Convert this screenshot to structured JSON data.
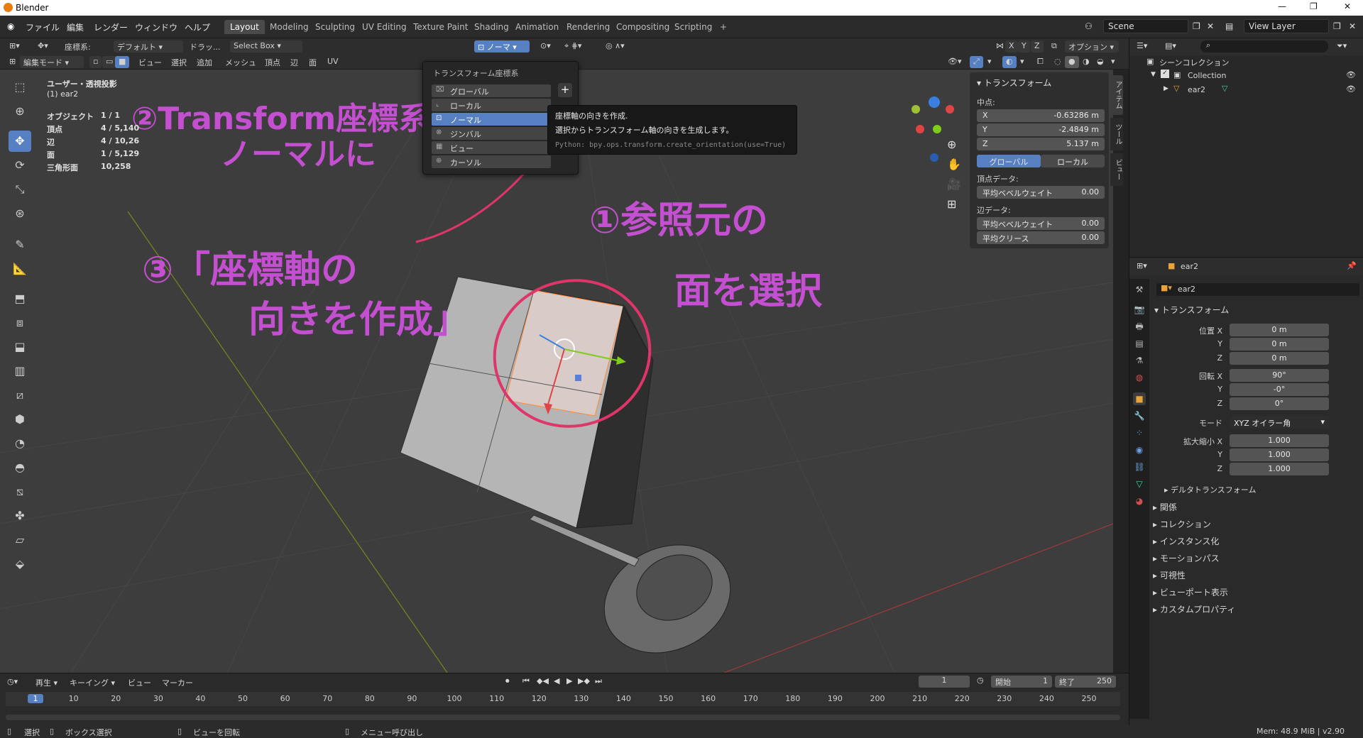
{
  "window": {
    "title": "Blender"
  },
  "topbar": {
    "menus": [
      "ファイル",
      "編集",
      "レンダー",
      "ウィンドウ",
      "ヘルプ"
    ],
    "workspaces": [
      "Layout",
      "Modeling",
      "Sculpting",
      "UV Editing",
      "Texture Paint",
      "Shading",
      "Animation",
      "Rendering",
      "Compositing",
      "Scripting"
    ],
    "active_workspace": "Layout",
    "scene": "Scene",
    "view_layer": "View Layer"
  },
  "header1": {
    "orientation_label": "座標系:",
    "orientation_value": "デフォルト",
    "drag_label": "ドラッ...",
    "drag_value": "Select Box",
    "transform_orientation": "ノーマ",
    "axes": [
      "X",
      "Y",
      "Z"
    ],
    "options": "オプション"
  },
  "header2": {
    "mode": "編集モード",
    "menus": [
      "ビュー",
      "選択",
      "追加",
      "メッシュ",
      "頂点",
      "辺",
      "面",
      "UV"
    ]
  },
  "overlay_info": {
    "view": "ユーザー・透視投影",
    "object": "(1) ear2",
    "rows": [
      {
        "label": "オブジェクト",
        "value": "1 / 1"
      },
      {
        "label": "頂点",
        "value": "4 / 5,140"
      },
      {
        "label": "辺",
        "value": "4 / 10,26"
      },
      {
        "label": "面",
        "value": "1 / 5,129"
      },
      {
        "label": "三角形面",
        "value": "10,258"
      }
    ]
  },
  "dropdown": {
    "title": "トランスフォーム座標系",
    "items": [
      "グローバル",
      "ローカル",
      "ノーマル",
      "ジンバル",
      "ビュー",
      "カーソル"
    ],
    "selected": "ノーマル",
    "plus": "+"
  },
  "tooltip": {
    "line1": "座標軸の向きを作成.",
    "line2": "選択からトランスフォーム軸の向きを生成します。",
    "python": "Python: bpy.ops.transform.create_orientation(use=True)"
  },
  "npanel": {
    "header": "トランスフォーム",
    "median": "中点:",
    "coords": [
      {
        "axis": "X",
        "value": "-0.63286 m"
      },
      {
        "axis": "Y",
        "value": "-2.4849 m"
      },
      {
        "axis": "Z",
        "value": "5.137 m"
      }
    ],
    "toggle": [
      "グローバル",
      "ローカル"
    ],
    "vertex_data": "頂点データ:",
    "v_bevel": {
      "label": "平均ベベルウェイト",
      "value": "0.00"
    },
    "edge_data": "辺データ:",
    "e_bevel": {
      "label": "平均ベベルウェイト",
      "value": "0.00"
    },
    "e_crease": {
      "label": "平均クリース",
      "value": "0.00"
    },
    "tabs": [
      "アイテム",
      "ツール",
      "ビュー"
    ]
  },
  "outliner": {
    "root": "シーンコレクション",
    "collection": "Collection",
    "object": "ear2"
  },
  "properties": {
    "object_name": "ear2",
    "name_field": "ear2",
    "transform_header": "トランスフォーム",
    "location": {
      "label": "位置 X",
      "values": [
        "0 m",
        "0 m",
        "0 m"
      ]
    },
    "rotation": {
      "label": "回転 X",
      "values": [
        "90°",
        "-0°",
        "0°"
      ]
    },
    "mode": {
      "label": "モード",
      "value": "XYZ オイラー角"
    },
    "scale": {
      "label": "拡大縮小 X",
      "values": [
        "1.000",
        "1.000",
        "1.000"
      ]
    },
    "yz": [
      "Y",
      "Z"
    ],
    "delta": "デルタトランスフォーム",
    "sections": [
      "関係",
      "コレクション",
      "インスタンス化",
      "モーションパス",
      "可視性",
      "ビューポート表示",
      "カスタムプロパティ"
    ]
  },
  "timeline": {
    "menus": [
      "再生",
      "キーイング",
      "ビュー",
      "マーカー"
    ],
    "current_frame": "1",
    "start_label": "開始",
    "start": "1",
    "end_label": "終了",
    "end": "250",
    "ticks": [
      "1",
      "10",
      "20",
      "30",
      "40",
      "50",
      "60",
      "70",
      "80",
      "90",
      "100",
      "110",
      "120",
      "130",
      "140",
      "150",
      "160",
      "170",
      "180",
      "190",
      "200",
      "210",
      "220",
      "230",
      "240",
      "250"
    ]
  },
  "statusbar": {
    "select": "選択",
    "box_select": "ボックス選択",
    "rotate_view": "ビューを回転",
    "call_menu": "メニュー呼び出し",
    "mem": "Mem: 48.9 MiB | v2.90"
  },
  "annotations": {
    "step2_line1": "②Transform座標系を",
    "step2_line2": "ノーマルに",
    "step3_line1": "③「座標軸の",
    "step3_line2": "向きを作成」",
    "step1_line1": "①参照元の",
    "step1_line2": "面を選択"
  },
  "colors": {
    "accent": "#5680c2",
    "annotation": "#c44fd0",
    "circle": "#e0356a"
  }
}
